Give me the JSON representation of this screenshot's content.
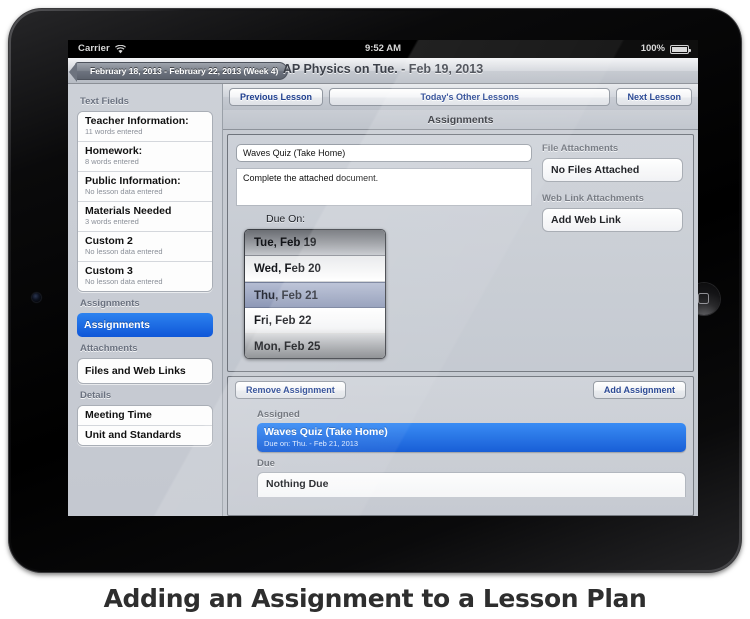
{
  "status_bar": {
    "carrier": "Carrier",
    "wifi_icon": "wifi-icon",
    "time": "9:52 AM",
    "battery_percent": "100%",
    "battery_icon": "battery-full-icon"
  },
  "nav_bar": {
    "back_button": "February 18, 2013 - February 22, 2013 (Week 4)",
    "title": "AP Physics on Tue. - Feb 19, 2013"
  },
  "sidebar": {
    "sections": [
      {
        "header": "Text Fields",
        "items": [
          {
            "title": "Teacher Information:",
            "sub": "11 words entered"
          },
          {
            "title": "Homework:",
            "sub": "8 words entered"
          },
          {
            "title": "Public Information:",
            "sub": "No lesson data entered"
          },
          {
            "title": "Materials Needed",
            "sub": "3 words entered"
          },
          {
            "title": "Custom 2",
            "sub": "No lesson data entered"
          },
          {
            "title": "Custom 3",
            "sub": "No lesson data entered"
          }
        ]
      },
      {
        "header": "Assignments",
        "items": [
          {
            "title": "Assignments",
            "selected": true
          }
        ]
      },
      {
        "header": "Attachments",
        "items": [
          {
            "title": "Files and Web Links"
          }
        ]
      },
      {
        "header": "Details",
        "items": [
          {
            "title": "Meeting Time"
          },
          {
            "title": "Unit and Standards"
          }
        ]
      }
    ]
  },
  "toolbar": {
    "previous_lesson": "Previous Lesson",
    "todays_other_lessons": "Today's Other Lessons",
    "next_lesson": "Next Lesson"
  },
  "subtitle": "Assignments",
  "editor": {
    "title_value": "Waves Quiz (Take Home)",
    "description_value": "Complete the attached document.",
    "due_on_label": "Due On:",
    "date_picker": {
      "options": [
        "Tue, Feb 19",
        "Wed, Feb 20",
        "Thu, Feb 21",
        "Fri, Feb 22",
        "Mon, Feb 25"
      ],
      "selected": "Thu, Feb 21",
      "selected_index": 2
    },
    "file_attachments_label": "File Attachments",
    "file_attachments_value": "No Files Attached",
    "web_link_attachments_label": "Web Link Attachments",
    "web_link_attachments_value": "Add Web Link"
  },
  "assignment_list": {
    "remove_button": "Remove Assignment",
    "add_button": "Add Assignment",
    "assigned_label": "Assigned",
    "assigned_items": [
      {
        "title": "Waves Quiz (Take Home)",
        "sub": "Due on: Thu. - Feb 21, 2013",
        "selected": true
      }
    ],
    "due_label": "Due",
    "due_items": [
      {
        "title": "Nothing Due"
      }
    ]
  },
  "caption": "Adding an Assignment to a Lesson Plan",
  "colors": {
    "selection_blue": "#0f56d8",
    "link_blue": "#1f3f8f",
    "sidebar_bg": "#c8ccd3",
    "bezel": "#050506"
  }
}
